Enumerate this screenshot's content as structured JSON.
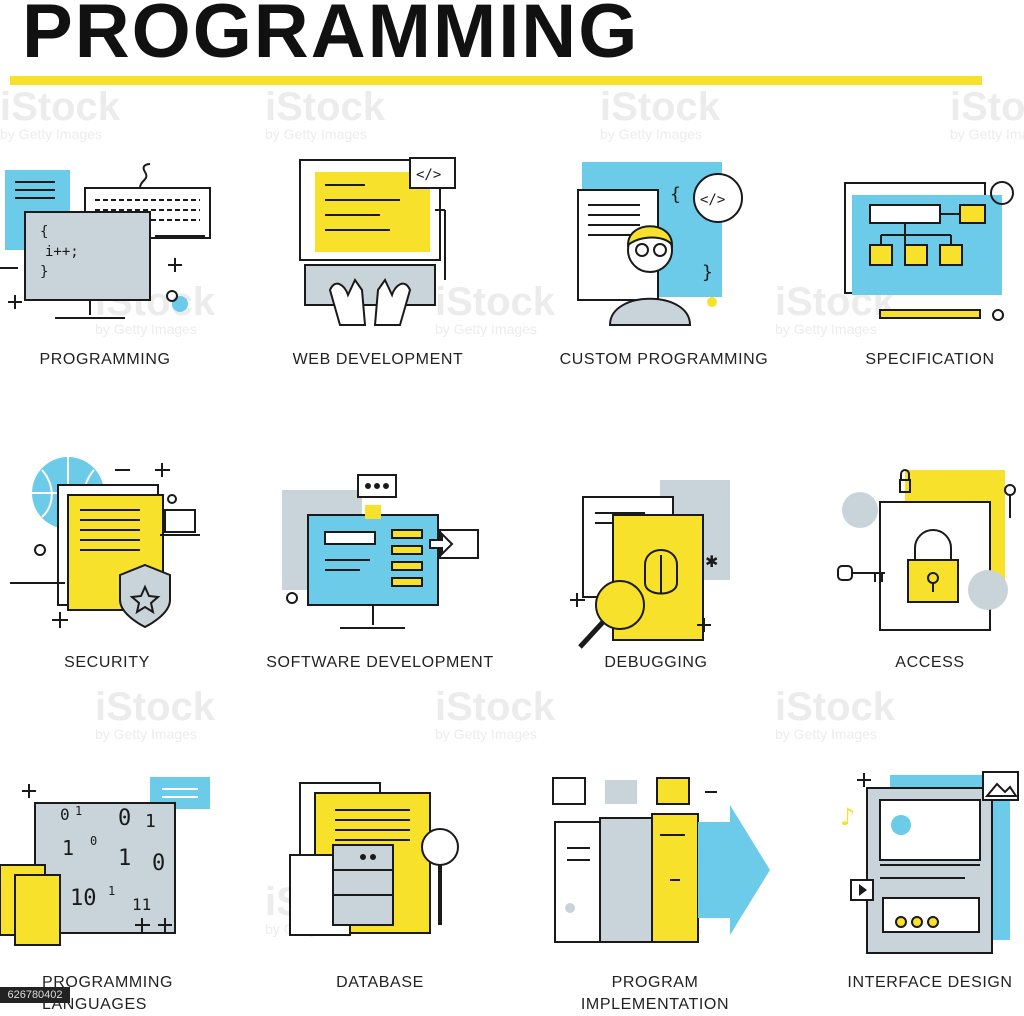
{
  "title": "PROGRAMMING",
  "watermark": {
    "text": "iStock",
    "sub": "by Getty Images"
  },
  "stock_id": "626780402",
  "colors": {
    "accent_yellow": "#f7e12b",
    "accent_blue": "#6ccbe8",
    "accent_gray": "#c8d3da",
    "line": "#1a1a1a"
  },
  "icons": [
    {
      "name": "programming",
      "label": "PROGRAMMING",
      "code": [
        "{",
        "i++;",
        "}"
      ]
    },
    {
      "name": "web-development",
      "label": "WEB DEVELOPMENT",
      "tag": "</>"
    },
    {
      "name": "custom-programming",
      "label": "CUSTOM PROGRAMMING",
      "tag": "</>"
    },
    {
      "name": "specification",
      "label": "SPECIFICATION"
    },
    {
      "name": "security",
      "label": "SECURITY"
    },
    {
      "name": "software-development",
      "label": "SOFTWARE DEVELOPMENT"
    },
    {
      "name": "debugging",
      "label": "DEBUGGING"
    },
    {
      "name": "access",
      "label": "ACCESS"
    },
    {
      "name": "programming-languages",
      "label_line1": "PROGRAMMING",
      "label_line2": "LANGUAGES"
    },
    {
      "name": "database",
      "label": "DATABASE"
    },
    {
      "name": "program-implementation",
      "label": "PROGRAM IMPLEMENTATION"
    },
    {
      "name": "interface-design",
      "label": "INTERFACE DESIGN"
    }
  ]
}
